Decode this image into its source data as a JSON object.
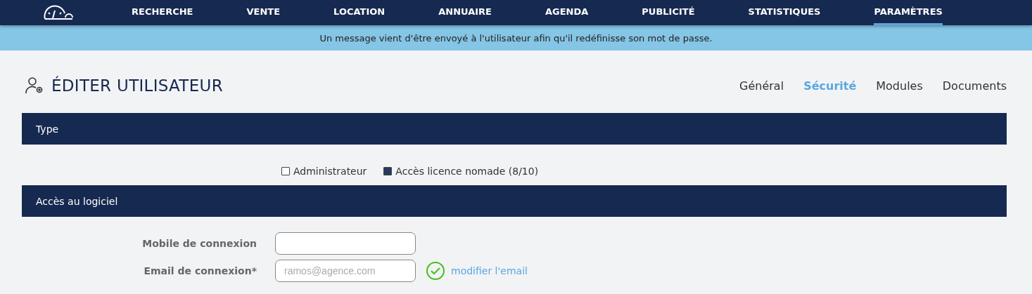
{
  "nav": {
    "items": [
      {
        "label": "RECHERCHE",
        "selected": false
      },
      {
        "label": "VENTE",
        "selected": false
      },
      {
        "label": "LOCATION",
        "selected": false
      },
      {
        "label": "ANNUAIRE",
        "selected": false
      },
      {
        "label": "AGENDA",
        "selected": false
      },
      {
        "label": "PUBLICITÉ",
        "selected": false
      },
      {
        "label": "STATISTIQUES",
        "selected": false
      },
      {
        "label": "PARAMÈTRES",
        "selected": true
      }
    ]
  },
  "banner": "Un message vient d'être envoyé à l'utilisateur afin qu'il redéfinisse son mot de passe.",
  "page": {
    "title": "ÉDITER UTILISATEUR",
    "tabs": [
      {
        "label": "Général",
        "selected": false
      },
      {
        "label": "Sécurité",
        "selected": true
      },
      {
        "label": "Modules",
        "selected": false
      },
      {
        "label": "Documents",
        "selected": false
      }
    ]
  },
  "type_section": {
    "title": "Type",
    "options": [
      {
        "label": "Administrateur",
        "checked": false
      },
      {
        "label": "Accès licence nomade (8/10)",
        "checked": true
      }
    ]
  },
  "access_section": {
    "title": "Accès au logiciel",
    "fields": [
      {
        "label": "Mobile de connexion"
      },
      {
        "label": "Email de connexion*",
        "placeholder": "ramos@agence.com",
        "valid": true,
        "link": "modifier l'email"
      }
    ]
  }
}
